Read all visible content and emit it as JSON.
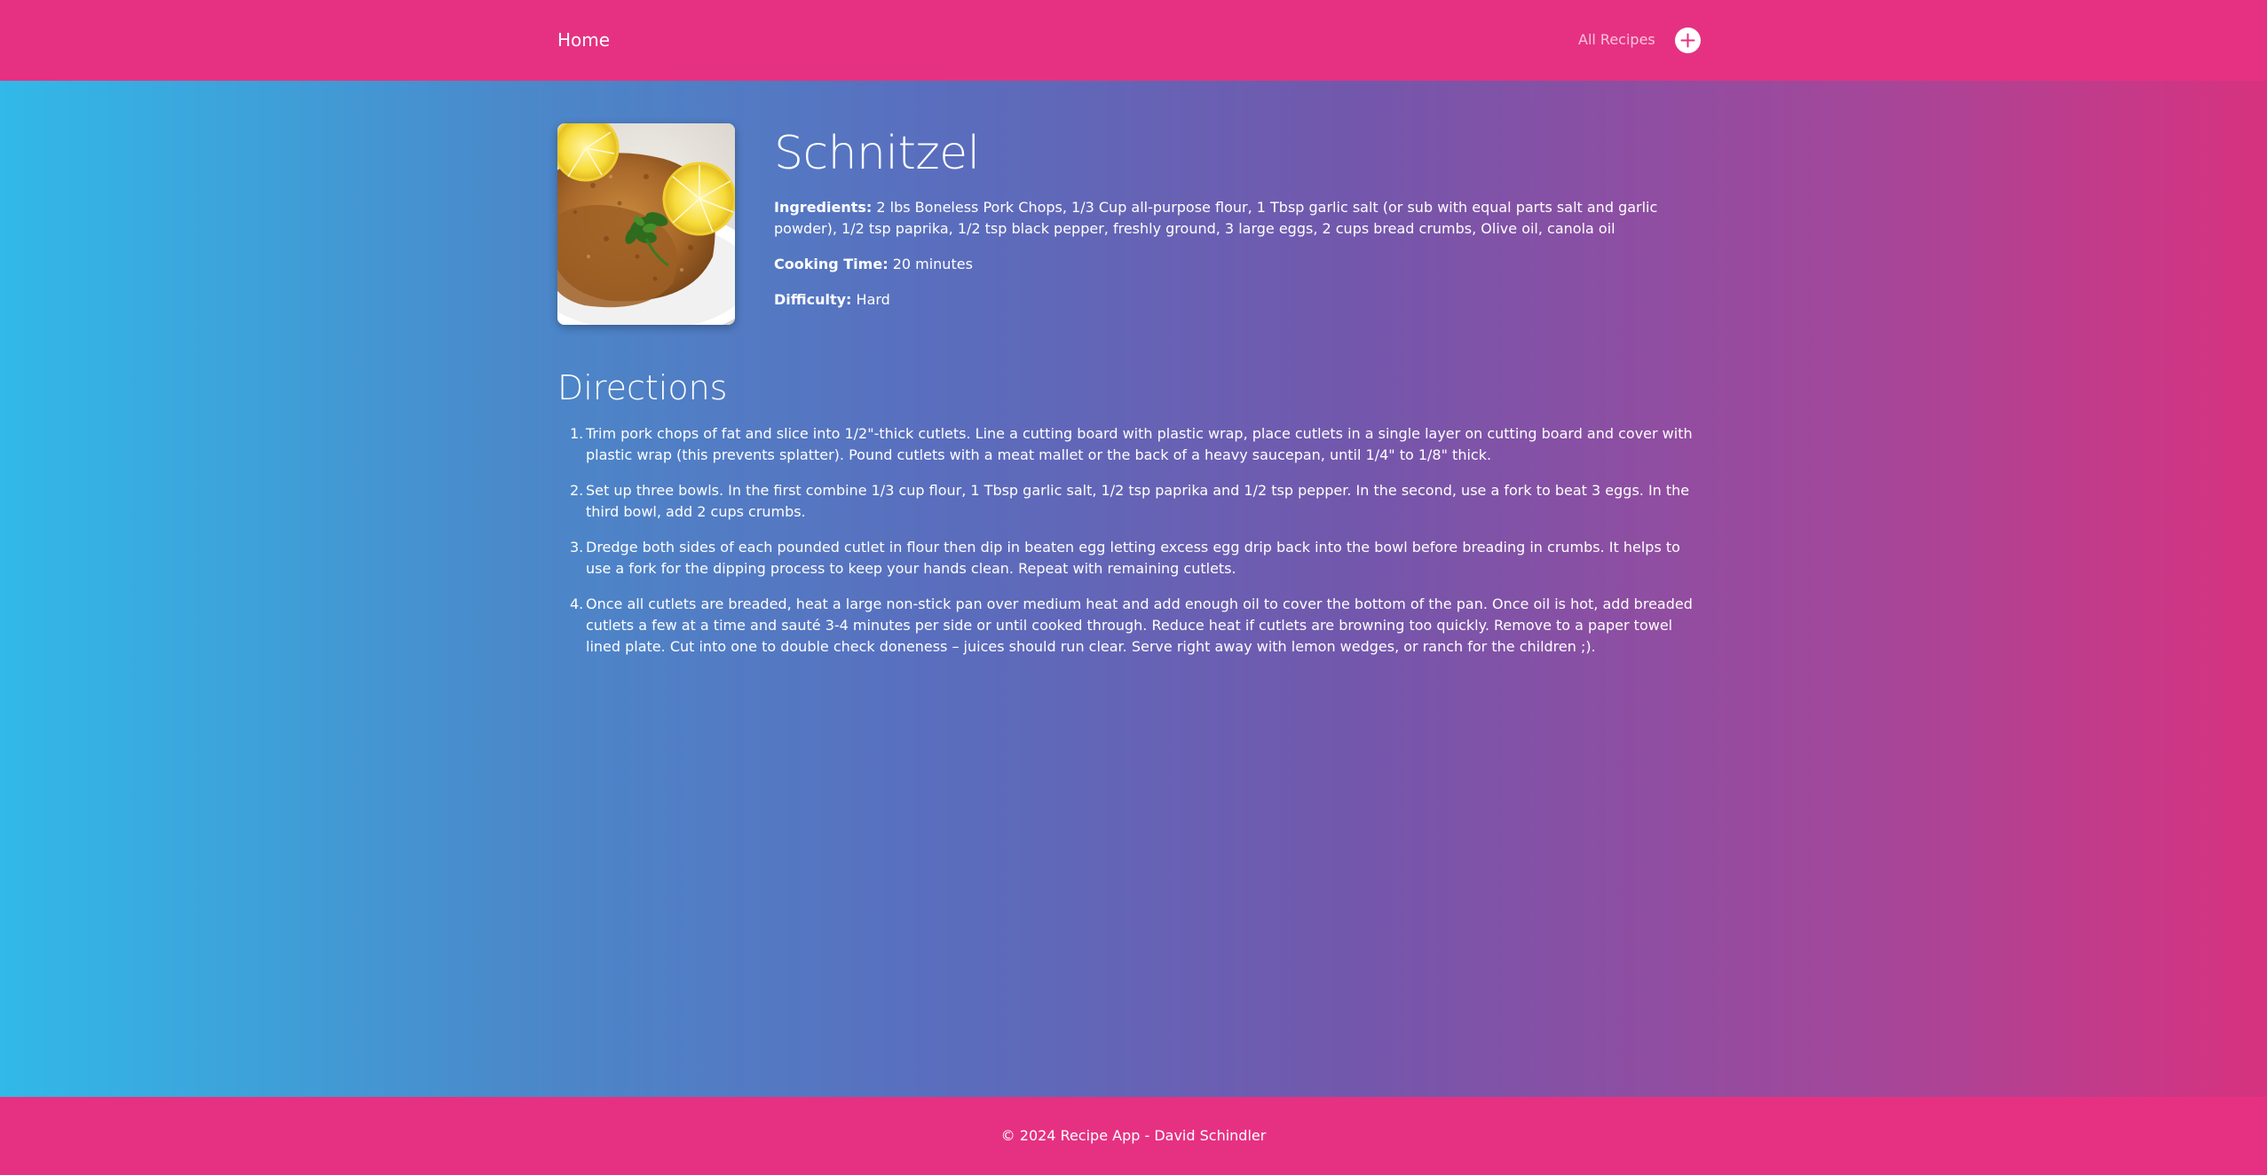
{
  "nav": {
    "home_label": "Home",
    "all_recipes_label": "All Recipes",
    "add_icon": "plus-circle-icon"
  },
  "recipe": {
    "image_alt": "Schnitzel",
    "title": "Schnitzel",
    "ingredients_label": "Ingredients:",
    "ingredients": "2 lbs Boneless Pork Chops, 1/3 Cup all-purpose flour, 1 Tbsp garlic salt (or sub with equal parts salt and garlic powder), 1/2 tsp paprika, 1/2 tsp black pepper, freshly ground, 3 large eggs, 2 cups bread crumbs, Olive oil, canola oil",
    "cooking_time_label": "Cooking Time:",
    "cooking_time": "20 minutes",
    "difficulty_label": "Difficulty:",
    "difficulty": "Hard"
  },
  "directions": {
    "heading": "Directions",
    "steps": [
      {
        "num": "1.",
        "text": "Trim pork chops of fat and slice into 1/2\"-thick cutlets. Line a cutting board with plastic wrap, place cutlets in a single layer on cutting board and cover with plastic wrap (this prevents splatter). Pound cutlets with a meat mallet or the back of a heavy saucepan, until 1/4\" to 1/8\" thick."
      },
      {
        "num": "2.",
        "text": "Set up three bowls. In the first combine 1/3 cup flour, 1 Tbsp garlic salt, 1/2 tsp paprika and 1/2 tsp pepper. In the second, use a fork to beat 3 eggs. In the third bowl, add 2 cups crumbs."
      },
      {
        "num": "3.",
        "text": "Dredge both sides of each pounded cutlet in flour then dip in beaten egg letting excess egg drip back into the bowl before breading in crumbs. It helps to use a fork for the dipping process to keep your hands clean. Repeat with remaining cutlets."
      },
      {
        "num": "4.",
        "text": "Once all cutlets are breaded, heat a large non-stick pan over medium heat and add enough oil to cover the bottom of the pan. Once oil is hot, add breaded cutlets a few at a time and sauté 3-4 minutes per side or until cooked through. Reduce heat if cutlets are browning too quickly. Remove to a paper towel lined plate. Cut into one to double check doneness – juices should run clear. Serve right away with lemon wedges, or ranch for the children ;)."
      }
    ]
  },
  "footer": {
    "text": "© 2024 Recipe App - David Schindler"
  },
  "colors": {
    "brand_pink": "#e63182",
    "gradient_start": "#31b9e8",
    "gradient_end": "#d7327f"
  }
}
